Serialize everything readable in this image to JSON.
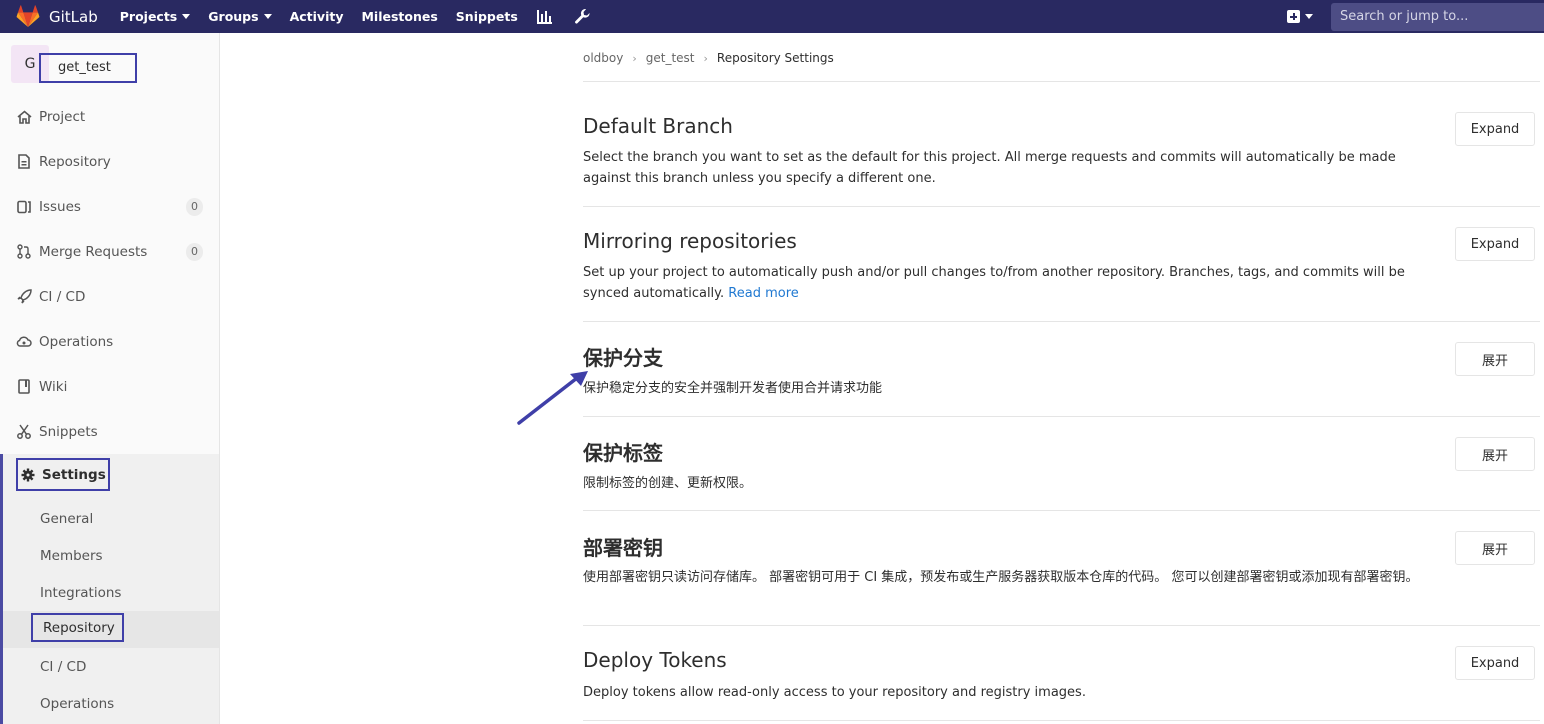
{
  "navbar": {
    "brand": "GitLab",
    "items": [
      {
        "label": "Projects",
        "dropdown": true
      },
      {
        "label": "Groups",
        "dropdown": true
      },
      {
        "label": "Activity",
        "dropdown": false
      },
      {
        "label": "Milestones",
        "dropdown": false
      },
      {
        "label": "Snippets",
        "dropdown": false
      }
    ],
    "search_placeholder": "Search or jump to..."
  },
  "sidebar": {
    "project_initial": "G",
    "project_name": "get_test",
    "items": [
      {
        "label": "Project",
        "icon": "home-icon"
      },
      {
        "label": "Repository",
        "icon": "doc-icon"
      },
      {
        "label": "Issues",
        "icon": "issues-icon",
        "badge": "0"
      },
      {
        "label": "Merge Requests",
        "icon": "merge-icon",
        "badge": "0"
      },
      {
        "label": "CI / CD",
        "icon": "rocket-icon"
      },
      {
        "label": "Operations",
        "icon": "cloud-icon"
      },
      {
        "label": "Wiki",
        "icon": "book-icon"
      },
      {
        "label": "Snippets",
        "icon": "scissors-icon"
      }
    ],
    "settings": {
      "label": "Settings",
      "sub_items": [
        "General",
        "Members",
        "Integrations",
        "Repository",
        "CI / CD",
        "Operations"
      ]
    }
  },
  "breadcrumb": [
    "oldboy",
    "get_test",
    "Repository Settings"
  ],
  "sections": [
    {
      "title": "Default Branch",
      "desc": "Select the branch you want to set as the default for this project. All merge requests and commits will automatically be made against this branch unless you specify a different one.",
      "button": "Expand"
    },
    {
      "title": "Mirroring repositories",
      "desc": "Set up your project to automatically push and/or pull changes to/from another repository. Branches, tags, and commits will be synced automatically.",
      "link": "Read more",
      "button": "Expand"
    },
    {
      "title": "保护分支",
      "desc": "保护稳定分支的安全并强制开发者使用合并请求功能",
      "button": "展开"
    },
    {
      "title": "保护标签",
      "desc": "限制标签的创建、更新权限。",
      "button": "展开"
    },
    {
      "title": "部署密钥",
      "desc": "使用部署密钥只读访问存储库。 部署密钥可用于 CI 集成，预发布或生产服务器获取版本仓库的代码。 您可以创建部署密钥或添加现有部署密钥。",
      "button": "展开"
    },
    {
      "title": "Deploy Tokens",
      "desc": "Deploy tokens allow read-only access to your repository and registry images.",
      "button": "Expand"
    }
  ],
  "colors": {
    "navbar": "#292961",
    "accent": "#4b4ba3",
    "link": "#1f78d1",
    "annotation": "#3f3fa8"
  }
}
